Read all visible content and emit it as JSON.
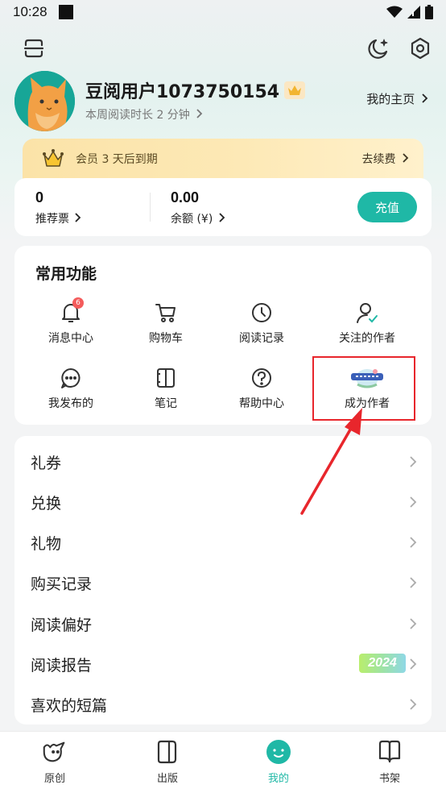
{
  "status_bar": {
    "time": "10:28"
  },
  "profile": {
    "username": "豆阅用户1073750154",
    "read_time": "本周阅读时长 2 分钟",
    "homepage_link": "我的主页"
  },
  "vip": {
    "text": "会员 3 天后到期",
    "renew": "去续费"
  },
  "wallet": {
    "tickets_value": "0",
    "tickets_label": "推荐票",
    "balance_value": "0.00",
    "balance_label": "余额 (¥)",
    "recharge_label": "充值"
  },
  "functions": {
    "title": "常用功能",
    "items": [
      {
        "label": "消息中心",
        "icon": "bell-icon",
        "badge": "6"
      },
      {
        "label": "购物车",
        "icon": "cart-icon"
      },
      {
        "label": "阅读记录",
        "icon": "clock-icon"
      },
      {
        "label": "关注的作者",
        "icon": "user-check-icon"
      },
      {
        "label": "我发布的",
        "icon": "chat-icon"
      },
      {
        "label": "笔记",
        "icon": "note-icon"
      },
      {
        "label": "帮助中心",
        "icon": "help-icon"
      },
      {
        "label": "成为作者",
        "icon": "become-author-icon"
      }
    ]
  },
  "menu": {
    "items": [
      {
        "label": "礼券"
      },
      {
        "label": "兑换"
      },
      {
        "label": "礼物"
      },
      {
        "label": "购买记录"
      },
      {
        "label": "阅读偏好"
      },
      {
        "label": "阅读报告",
        "badge": "2024"
      },
      {
        "label": "喜欢的短篇"
      }
    ]
  },
  "bottom_nav": {
    "items": [
      {
        "label": "原创",
        "icon": "bird-icon"
      },
      {
        "label": "出版",
        "icon": "book-icon"
      },
      {
        "label": "我的",
        "icon": "smile-icon",
        "active": true
      },
      {
        "label": "书架",
        "icon": "bookshelf-icon"
      }
    ]
  },
  "colors": {
    "accent": "#1fb8a6",
    "highlight": "#e8262c",
    "vip_gold": "#fbe3a8"
  }
}
